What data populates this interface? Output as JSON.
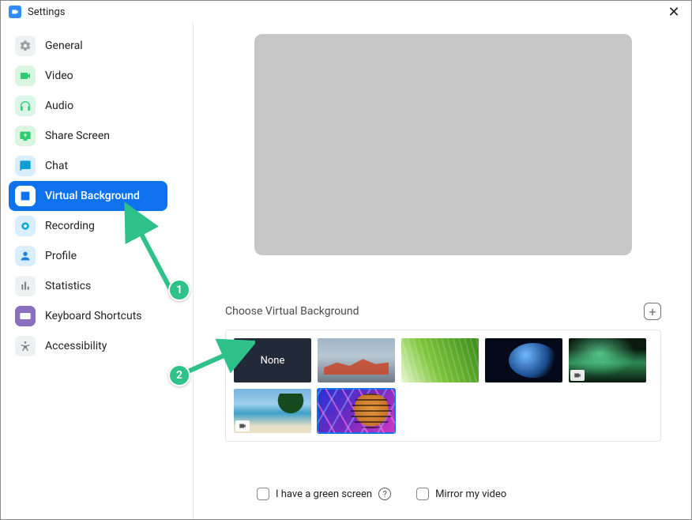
{
  "window": {
    "title": "Settings"
  },
  "sidebar": {
    "items": [
      {
        "label": "General",
        "icon": "gear",
        "bg": "#eef0f2",
        "fg": "#7e7e7e"
      },
      {
        "label": "Video",
        "icon": "video",
        "bg": "#d9f6e0",
        "fg": "#2ecc71"
      },
      {
        "label": "Audio",
        "icon": "audio",
        "bg": "#d9f6e8",
        "fg": "#2ecc71"
      },
      {
        "label": "Share Screen",
        "icon": "share",
        "bg": "#d9f6e0",
        "fg": "#2ecc71"
      },
      {
        "label": "Chat",
        "icon": "chat",
        "bg": "#d9eefc",
        "fg": "#0e9ed8"
      },
      {
        "label": "Virtual Background",
        "icon": "vb",
        "bg": "#0e72ed",
        "fg": "#fff",
        "active": true
      },
      {
        "label": "Recording",
        "icon": "record",
        "bg": "#d9eefc",
        "fg": "#0ea5d8"
      },
      {
        "label": "Profile",
        "icon": "profile",
        "bg": "#d9eefc",
        "fg": "#1a82e2"
      },
      {
        "label": "Statistics",
        "icon": "stats",
        "bg": "#eef0f2",
        "fg": "#7e7e7e"
      },
      {
        "label": "Keyboard Shortcuts",
        "icon": "keyboard",
        "bg": "#8a6fbf",
        "fg": "#fff"
      },
      {
        "label": "Accessibility",
        "icon": "access",
        "bg": "#eef0f2",
        "fg": "#7e7e7e"
      }
    ]
  },
  "main": {
    "choose_label": "Choose Virtual Background",
    "none_label": "None",
    "options": {
      "green_screen": "I have a green screen",
      "mirror": "Mirror my video"
    }
  },
  "annotations": {
    "marker1": "1",
    "marker2": "2"
  },
  "backgrounds": [
    {
      "name": "none",
      "type": "none"
    },
    {
      "name": "golden-gate",
      "type": "img"
    },
    {
      "name": "grass",
      "type": "img"
    },
    {
      "name": "earth-space",
      "type": "img"
    },
    {
      "name": "aurora",
      "type": "video"
    },
    {
      "name": "beach",
      "type": "video"
    },
    {
      "name": "tiger-retro",
      "type": "img",
      "selected": true
    }
  ]
}
